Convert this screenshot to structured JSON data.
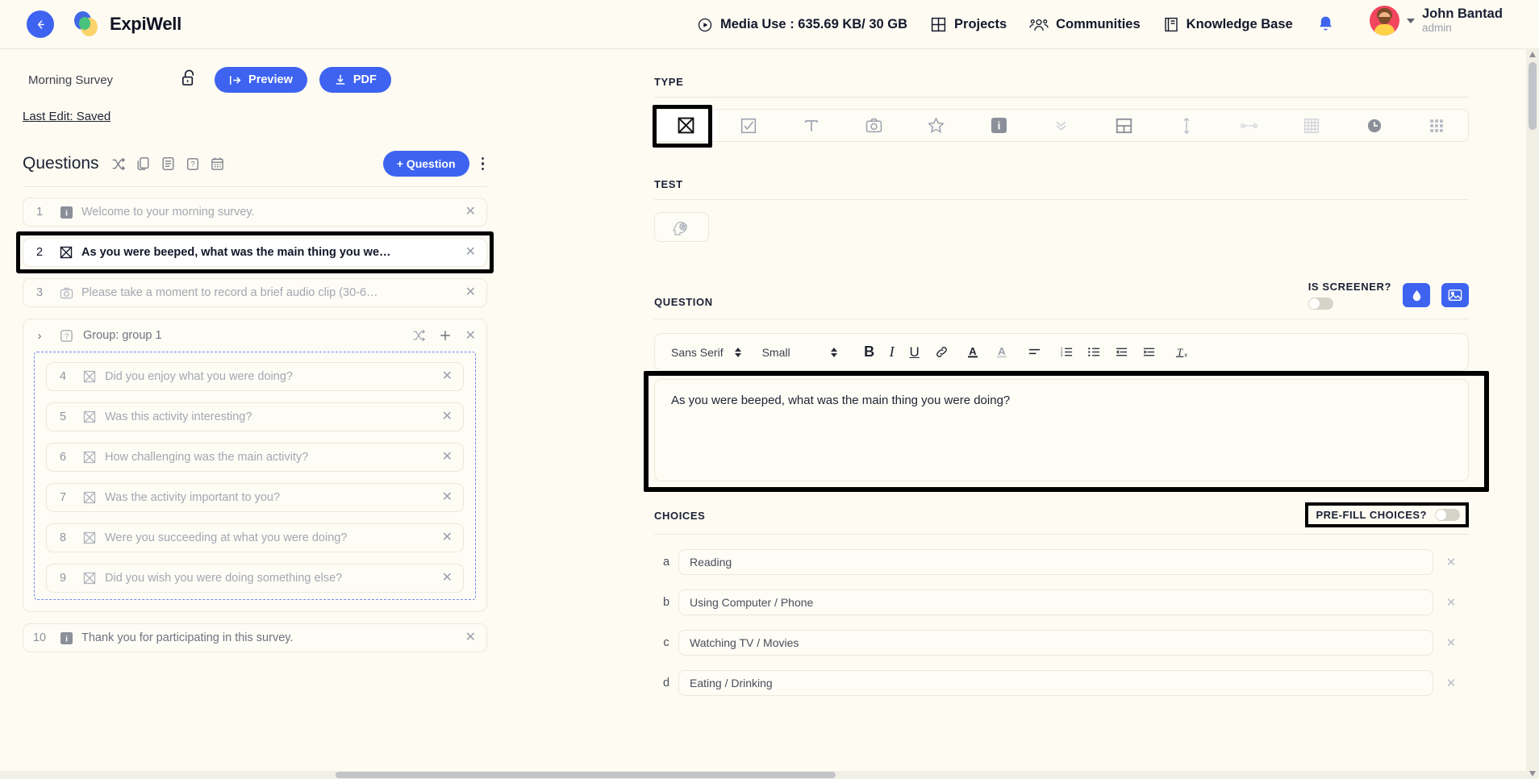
{
  "header": {
    "back_icon": "back-arrow-icon",
    "brand": "ExpiWell",
    "media_use": "Media Use : 635.69 KB/ 30 GB",
    "nav": [
      {
        "label": "Projects",
        "icon": "grid-icon"
      },
      {
        "label": "Communities",
        "icon": "people-icon"
      },
      {
        "label": "Knowledge Base",
        "icon": "book-icon"
      }
    ],
    "bell_icon": "bell-icon",
    "user": {
      "name": "John Bantad",
      "role": "admin"
    },
    "colors": {
      "accent": "#3e63f0",
      "page_bg": "#fdfbf2"
    }
  },
  "left_panel": {
    "survey_name": "Morning Survey",
    "lock_icon": "unlock-icon",
    "preview_label": "Preview",
    "pdf_label": "PDF",
    "last_edit": "Last Edit: Saved",
    "questions_title": "Questions",
    "tool_icons": [
      "shuffle-icon",
      "copy-icon",
      "list-icon",
      "help-icon",
      "calendar-icon"
    ],
    "add_question_label": "+ Question",
    "kebab_icon": "more-vertical-icon",
    "rows": [
      {
        "num": "1",
        "icon": "info-icon",
        "text": "Welcome to your morning survey.",
        "selected": false
      },
      {
        "num": "2",
        "icon": "multiple-choice-icon",
        "text": "As you were beeped, what was the main thing you we…",
        "selected": true
      },
      {
        "num": "3",
        "icon": "camera-icon",
        "text": "Please take a moment to record a brief audio clip (30-6…",
        "selected": false
      }
    ],
    "group": {
      "chevron": "›",
      "icon": "help-box-icon",
      "label": "Group: group 1",
      "actions": [
        "shuffle-icon",
        "plus-icon",
        "close-icon"
      ],
      "rows": [
        {
          "num": "4",
          "icon": "multiple-choice-icon",
          "text": "Did you enjoy what you were doing?"
        },
        {
          "num": "5",
          "icon": "multiple-choice-icon",
          "text": "Was this activity interesting?"
        },
        {
          "num": "6",
          "icon": "multiple-choice-icon",
          "text": "How challenging was the main activity?"
        },
        {
          "num": "7",
          "icon": "multiple-choice-icon",
          "text": "Was the activity important to you?"
        },
        {
          "num": "8",
          "icon": "multiple-choice-icon",
          "text": "Were you succeeding at what you were doing?"
        },
        {
          "num": "9",
          "icon": "multiple-choice-icon",
          "text": "Did you wish you were doing something else?"
        }
      ]
    },
    "last_row": {
      "num": "10",
      "icon": "info-icon",
      "text": "Thank you for participating in this survey.",
      "selected": false
    }
  },
  "right_panel": {
    "type_label": "TYPE",
    "type_icons": [
      "multiple-choice-icon",
      "checkbox-icon",
      "text-icon",
      "camera-icon",
      "star-icon",
      "info-icon",
      "chevrons-down-icon",
      "layout-icon",
      "vertical-slider-icon",
      "horizontal-slider-icon",
      "matrix-icon",
      "clock-icon",
      "grid-icon"
    ],
    "type_selected_index": 0,
    "test_label": "TEST",
    "test_icon": "brain-head-icon",
    "question_label": "QUESTION",
    "is_screener_label": "IS SCREENER?",
    "is_screener_on": false,
    "action_icons": [
      "ink-drop-icon",
      "image-icon"
    ],
    "rte": {
      "font_family": "Sans Serif",
      "font_size": "Small",
      "buttons": [
        "bold-icon",
        "italic-icon",
        "underline-icon",
        "link-icon",
        "font-color-icon",
        "highlight-icon",
        "align-icon",
        "ordered-list-icon",
        "bullet-list-icon",
        "outdent-icon",
        "indent-icon",
        "clear-format-icon"
      ]
    },
    "question_text": "As you were beeped, what was the main thing you were doing?",
    "choices_label": "CHOICES",
    "prefill_label": "PRE-FILL CHOICES?",
    "prefill_on": false,
    "choices": [
      {
        "letter": "a",
        "value": "Reading"
      },
      {
        "letter": "b",
        "value": "Using Computer / Phone"
      },
      {
        "letter": "c",
        "value": "Watching TV / Movies"
      },
      {
        "letter": "d",
        "value": "Eating / Drinking"
      }
    ]
  }
}
